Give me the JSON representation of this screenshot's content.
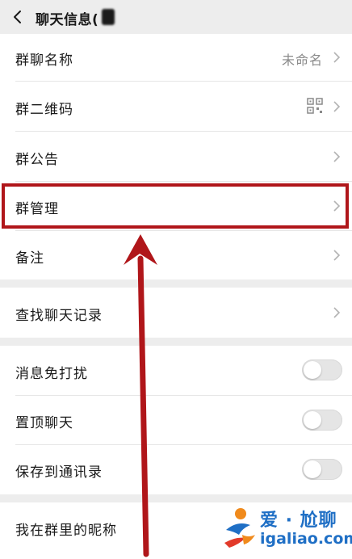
{
  "header": {
    "title": "聊天信息(",
    "back_icon": "chevron-left-icon"
  },
  "rows": {
    "group_name": {
      "label": "群聊名称",
      "value": "未命名"
    },
    "qr_code": {
      "label": "群二维码",
      "icon": "qr-code-icon"
    },
    "announcement": {
      "label": "群公告"
    },
    "management": {
      "label": "群管理"
    },
    "remark": {
      "label": "备注"
    },
    "search_history": {
      "label": "查找聊天记录"
    },
    "mute": {
      "label": "消息免打扰",
      "enabled": false
    },
    "pin": {
      "label": "置顶聊天",
      "enabled": false
    },
    "save_contacts": {
      "label": "保存到通讯录",
      "enabled": false
    },
    "nickname": {
      "label": "我在群里的昵称"
    }
  },
  "annotation": {
    "highlight_color": "#b0161a",
    "arrow_color": "#b0161a"
  },
  "watermark": {
    "text": "爱 · 尬聊",
    "url": "igaliao.com",
    "color": "#1f6fc5"
  }
}
